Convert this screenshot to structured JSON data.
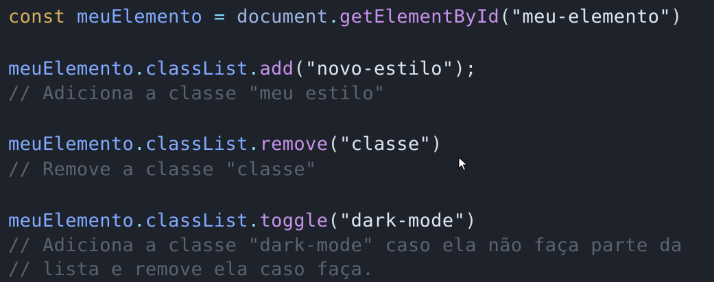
{
  "code": {
    "line1": {
      "keyword": "const",
      "var": "meuElemento",
      "op": "=",
      "obj": "document",
      "dot": ".",
      "method": "getElementById",
      "open": "(",
      "string": "\"meu-elemento\"",
      "close": ")"
    },
    "line2": {
      "obj": "meuElemento",
      "dot1": ".",
      "prop": "classList",
      "dot2": ".",
      "method": "add",
      "open": "(",
      "string": "\"novo-estilo\"",
      "close": ");"
    },
    "line3": {
      "comment": "// Adiciona a classe \"meu estilo\""
    },
    "line4": {
      "obj": "meuElemento",
      "dot1": ".",
      "prop": "classList",
      "dot2": ".",
      "method": "remove",
      "open": "(",
      "string": "\"classe\"",
      "close": ")"
    },
    "line5": {
      "comment": "// Remove a classe \"classe\""
    },
    "line6": {
      "obj": "meuElemento",
      "dot1": ".",
      "prop": "classList",
      "dot2": ".",
      "method": "toggle",
      "open": "(",
      "string": "\"dark-mode\"",
      "close": ")"
    },
    "line7": {
      "comment": "// Adiciona a classe \"dark-mode\" caso ela não faça parte da"
    },
    "line8": {
      "comment": "// lista e remove ela caso faça."
    }
  },
  "colors": {
    "background": "#1e222a",
    "keyword": "#d8b15b",
    "variable": "#82aaff",
    "method": "#c792ea",
    "string": "#dfe6f3",
    "comment": "#5c6370"
  },
  "icons": {
    "cursor": "mouse-pointer-icon"
  }
}
